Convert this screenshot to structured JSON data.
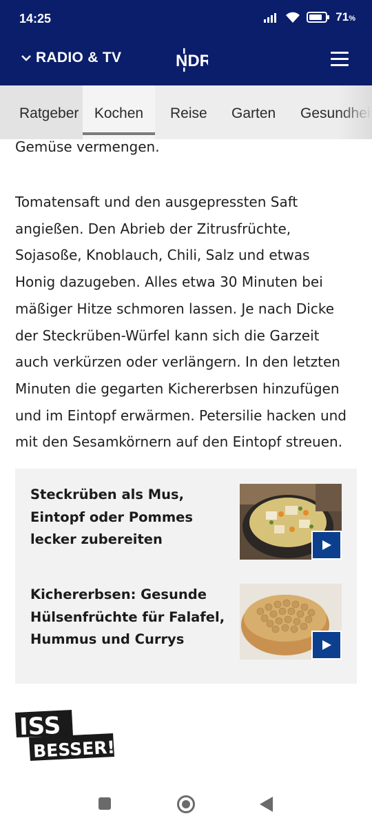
{
  "status_bar": {
    "time": "14:25",
    "battery_percent": "71",
    "battery_unit": "%",
    "icons": [
      "signal-icon",
      "wifi-icon",
      "battery-icon"
    ]
  },
  "header": {
    "section_label": "RADIO & TV",
    "logo_text": "NDR",
    "menu_icon": "hamburger-menu-icon",
    "background_color": "#0b1e6b"
  },
  "tabs": {
    "items": [
      {
        "label": "Ratgeber"
      },
      {
        "label": "Kochen"
      },
      {
        "label": "Reise"
      },
      {
        "label": "Garten"
      },
      {
        "label": "Gesundheit"
      }
    ],
    "active": "Kochen"
  },
  "article": {
    "partial_line": "Gemüse vermengen.",
    "paragraph_lines": [
      "Tomatensaft und den ausgepressten Saft",
      "angießen. Den Abrieb der Zitrusfrüchte,",
      "Sojasoße, Knoblauch, Chili, Salz und etwas",
      "Honig dazugeben. Alles etwa 30 Minuten bei",
      "mäßiger Hitze schmoren lassen. Je nach Dicke",
      "der Steckrüben-Würfel kann sich die Garzeit",
      "auch verkürzen oder verlängern. In den letzten",
      "Minuten die gegarten Kichererbsen hinzufügen",
      "und im Eintopf erwärmen. Petersilie hacken und",
      "mit den Sesamkörnern auf den Eintopf streuen."
    ]
  },
  "related": [
    {
      "title_lines": [
        "Steckrüben als Mus,",
        "Eintopf oder Pommes",
        "lecker zubereiten"
      ],
      "image": "stew-bowl-image",
      "badge_icon": "play-icon"
    },
    {
      "title_lines": [
        "Kichererbsen: Gesunde",
        "Hülsenfrüchte für Falafel,",
        "Hummus und Currys"
      ],
      "image": "chickpeas-bowl-image",
      "badge_icon": "play-icon"
    }
  ],
  "brand_logo": {
    "line1": "ISS",
    "line2": "BESSER!"
  },
  "nav_bar": {
    "icons": [
      "recents-square-icon",
      "home-circle-icon",
      "back-triangle-icon"
    ]
  }
}
